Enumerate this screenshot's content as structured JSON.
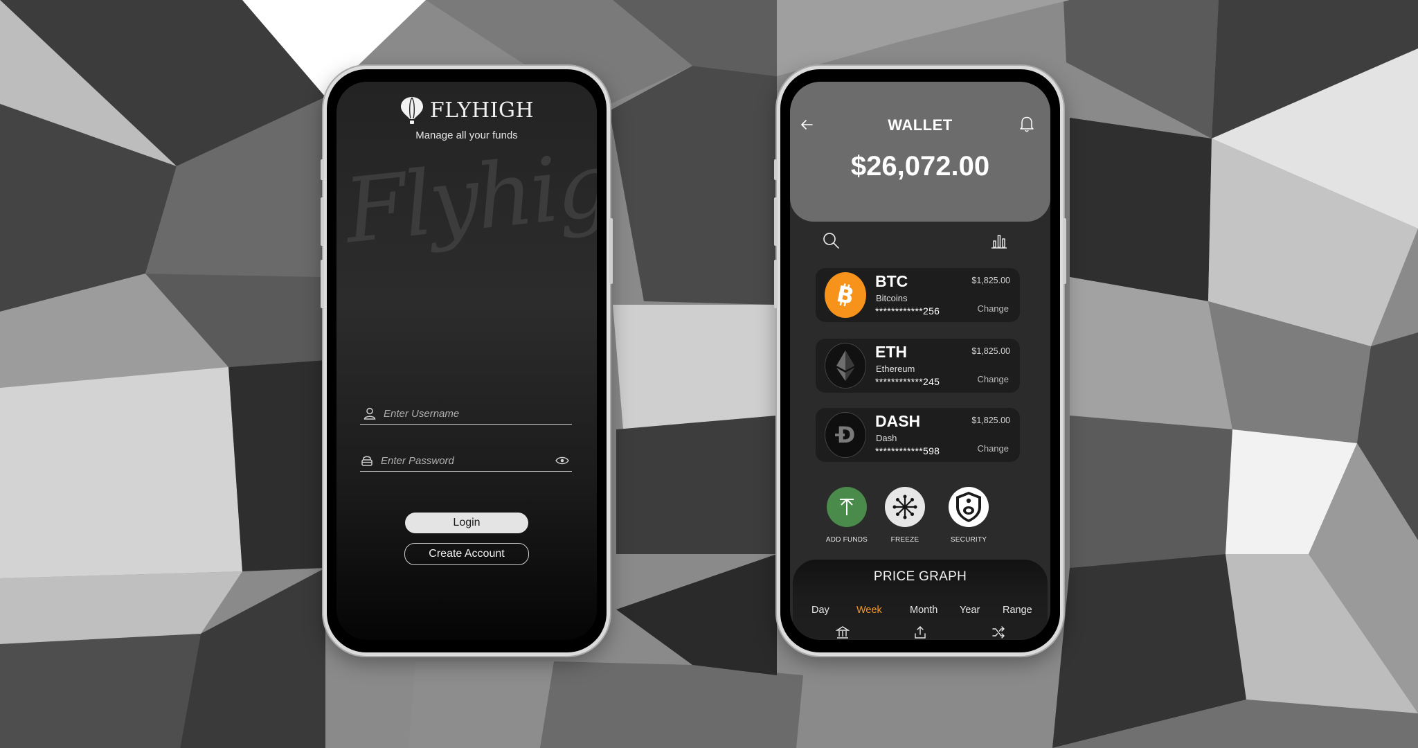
{
  "login": {
    "brand_name": "FLYHIGH",
    "tagline": "Manage all your funds",
    "watermark_text": "Flyhigh",
    "username_placeholder": "Enter Username",
    "password_placeholder": "Enter Password",
    "login_label": "Login",
    "create_account_label": "Create Account",
    "icons": [
      "balloon-icon",
      "user-icon",
      "lock-icon",
      "eye-icon",
      "fingerprint-icon"
    ]
  },
  "wallet": {
    "title": "WALLET",
    "balance": "$26,072.00",
    "coins": [
      {
        "symbol": "BTC",
        "name": "Bitcoins",
        "account": "************256",
        "amount": "$1,825.00",
        "change_label": "Change",
        "color": "#F7931A"
      },
      {
        "symbol": "ETH",
        "name": "Ethereum",
        "account": "************245",
        "amount": "$1,825.00",
        "change_label": "Change",
        "color": "#111111"
      },
      {
        "symbol": "DASH",
        "name": "Dash",
        "account": "************598",
        "amount": "$1,825.00",
        "change_label": "Change",
        "color": "#111111"
      }
    ],
    "actions": [
      {
        "label": "ADD FUNDS",
        "icon": "arrow-up-icon",
        "color": "#4A8A4A"
      },
      {
        "label": "FREEZE",
        "icon": "snowflake-icon",
        "color": "#E6E6E6"
      },
      {
        "label": "SECURITY",
        "icon": "shield-lock-icon",
        "color": "#FFFFFF"
      }
    ],
    "graph_title": "PRICE GRAPH",
    "ranges": [
      "Day",
      "Week",
      "Month",
      "Year",
      "Range"
    ],
    "active_range": "Week",
    "accent_color": "#F0962A",
    "bottom_icons": [
      "bank-icon",
      "upload-icon",
      "shuffle-icon"
    ]
  }
}
